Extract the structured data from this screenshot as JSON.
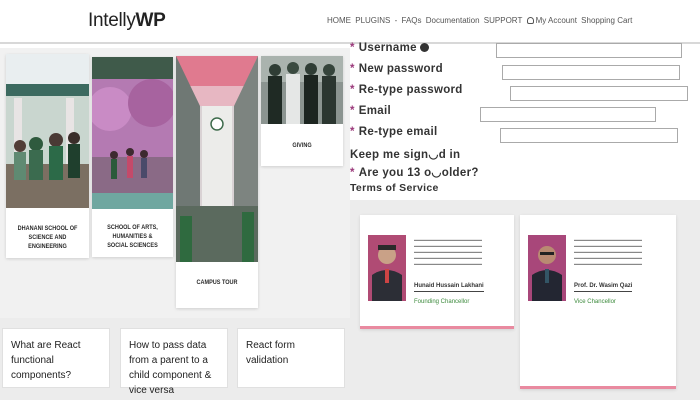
{
  "header": {
    "logo_regular": "Intelly",
    "logo_bold": "WP",
    "nav": [
      "HOME",
      "PLUGINS",
      "-",
      "FAQs",
      "Documentation",
      "SUPPORT",
      "My Account",
      "Shopping Cart"
    ]
  },
  "campus_cards": [
    {
      "caption": "DHANANI SCHOOL OF SCIENCE AND ENGINEERING"
    },
    {
      "caption": "SCHOOL OF ARTS, HUMANITIES & SOCIAL SCIENCES"
    },
    {
      "caption": "CAMPUS TOUR"
    },
    {
      "caption": "GIVING"
    }
  ],
  "form": {
    "username": "Username",
    "new_password": "New password",
    "retype_password": "Re-type password",
    "email": "Email",
    "retype_email": "Re-type email",
    "keep_signed": "Keep me sign◡d in",
    "age_question": "Are you 13 o◡older?",
    "terms": "Terms of Service",
    "star": "*"
  },
  "people": [
    {
      "name": "Hunaid Hussain Lakhani",
      "role": "Founding Chancellor"
    },
    {
      "name": "Prof. Dr. Wasim Qazi",
      "role": "Vice Chancellor"
    }
  ],
  "articles": [
    {
      "title": "What are React functional components?"
    },
    {
      "title": "How to pass data from a parent to a child component & vice versa"
    },
    {
      "title": "React form validation"
    }
  ],
  "colors": {
    "accent_pink": "#e98aa0",
    "star": "#9b3a7b",
    "role_green": "#3c8a3c"
  }
}
